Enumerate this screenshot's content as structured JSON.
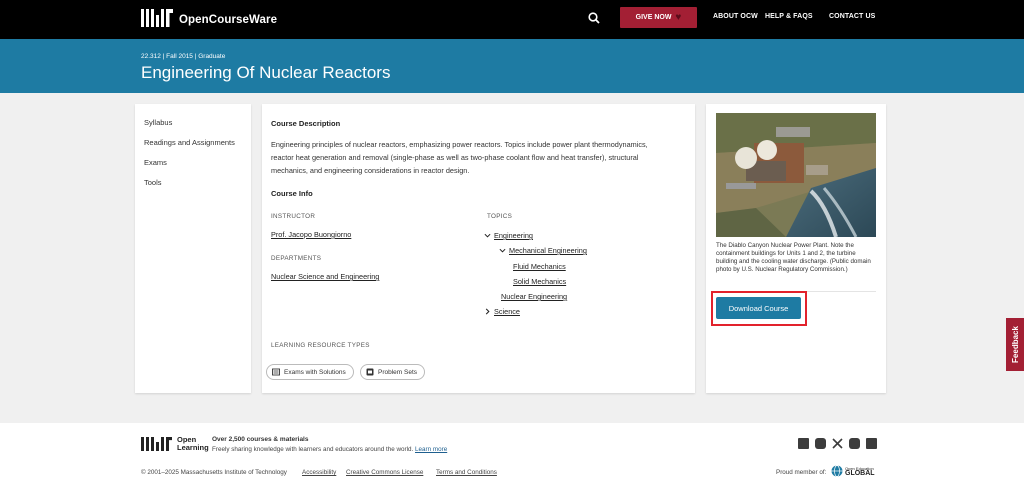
{
  "nav": {
    "logo_text": "OpenCourseWare",
    "give_label": "GIVE NOW",
    "about_label": "ABOUT OCW",
    "help_label": "HELP & FAQS",
    "contact_label": "CONTACT US"
  },
  "course": {
    "meta": "22.312 | Fall 2015 | Graduate",
    "title": "Engineering Of Nuclear Reactors"
  },
  "sidebar": {
    "items": [
      {
        "label": "Syllabus"
      },
      {
        "label": "Readings and Assignments"
      },
      {
        "label": "Exams"
      },
      {
        "label": "Tools"
      }
    ]
  },
  "main": {
    "desc_heading": "Course Description",
    "description": "Engineering principles of nuclear reactors, emphasizing power reactors. Topics include power plant thermodynamics, reactor heat generation and removal (single-phase as well as two-phase coolant flow and heat transfer), structural mechanics, and engineering considerations in reactor design.",
    "info_heading": "Course Info",
    "instructor_label": "INSTRUCTOR",
    "instructor": "Prof. Jacopo Buongiorno",
    "departments_label": "DEPARTMENTS",
    "department": "Nuclear Science and Engineering",
    "topics_label": "TOPICS",
    "topics": {
      "engineering": "Engineering",
      "mechanical": "Mechanical Engineering",
      "fluid": "Fluid Mechanics",
      "solid": "Solid Mechanics",
      "nuclear": "Nuclear Engineering",
      "science": "Science"
    },
    "lrt_label": "LEARNING RESOURCE TYPES",
    "chips": [
      {
        "label": "Exams with Solutions"
      },
      {
        "label": "Problem Sets"
      }
    ]
  },
  "right": {
    "caption": "The Diablo Canyon Nuclear Power Plant. Note the containment buildings for Units 1 and 2, the turbine building and the cooling water discharge. (Public domain photo by U.S. Nuclear Regulatory Commission.)",
    "download_label": "Download Course"
  },
  "feedback_label": "Feedback",
  "footer": {
    "ol_line1": "Open",
    "ol_line2": "Learning",
    "headline": "Over 2,500 courses & materials",
    "sub": "Freely sharing knowledge with learners and educators around the world.",
    "learn_more": "Learn more",
    "copyright": "© 2001–2025 Massachusetts Institute of Technology",
    "accessibility": "Accessibility",
    "license": "Creative Commons License",
    "terms": "Terms and Conditions",
    "proud": "Proud member of:",
    "oeg_line1": "Open Education",
    "oeg_line2": "GLOBAL"
  },
  "colors": {
    "banner": "#1e7ba3",
    "accent_red": "#a31f34",
    "highlight": "#e2222c"
  }
}
